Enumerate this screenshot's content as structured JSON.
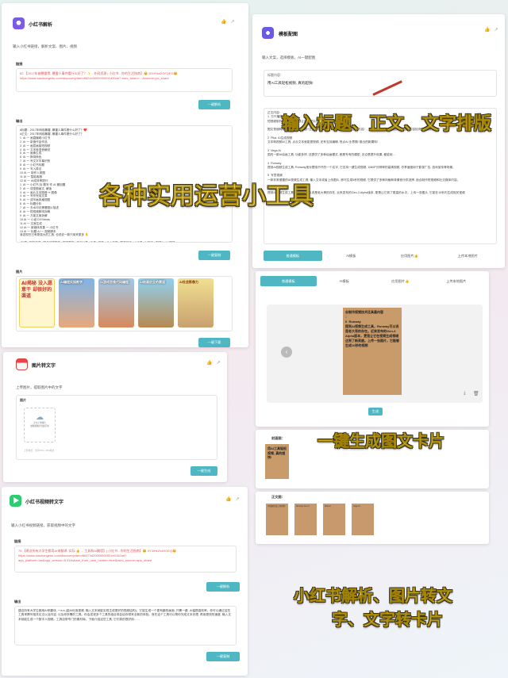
{
  "p1": {
    "title": "小红书解析",
    "subtitle": "输入小红书链接，解析文案、图片、视频",
    "link_label": "链接",
    "link_text": "62 【2017年被暴雷黑, 暴雷人事件看什么好了？✨ - 外网资源 | 小红书 - 你的生活指南】😊 2EHYkeZGFQEG😊 https://www.xiaohongshu.com/discovery/item/6624c0000000001d00ab? xsec_token=...&source=pc_share",
    "parse_button": "一键解析",
    "output_label": "输出",
    "output_lines": [
      "#标题：2017年网络暴雷, 暴雷人事件看什么好了？❤️",
      "#正文：2017年网络暴雷, 暴雷人事件看什么好了？",
      "1  AI 一 画直播助小红书",
      "2  AI 一 制造作品作品",
      "3  AI 一 画层画接短视频",
      "4  AI 一 文本转语音解说",
      "5  AI 一 画像生成",
      "6  AI 一 换背换色",
      "7  AI 一 写文字字幕识别",
      "8  AI 一 小红书标题",
      "9  AI 一 写入算法",
      "10 AI 一 制作人类图",
      "11 AI 一 智能客服",
      "12 AI 一 AI成效率提升",
      "1  AI 一 小红书 标 题写 作 AI 撤回置",
      "2  AI 一 成型图画文, 解读",
      "3  AI 一 画片文本图像 ✈ 图像",
      "4  AI 一 写作完成文章",
      "5  AI 一 成写画风格视图",
      "6  AI 一 标题分析",
      "7  AI 一 去水印无需看图片描述",
      "8  AI 一 短视频脚本拆解",
      "9  AI 一 万能文案拆解",
      "10 AI 一 小纸 DIY/Ideas",
      "11 AI 一 文案生成",
      "12 AI 一 新媒体改善 一 小红书",
      "13 AI 一 标题 AI 一 视频脚本",
      "我发现在已有更强大的工具, 也说说一款只用来更多 ✋",
      "",
      "#标签 #职场效率 #精品效率推荐 #视频教程 #用户分享 #工具 #学生 #个人效率 #职场技巧 #AI工具 #AI知识 #视频AI #AI视频"
    ],
    "copy_button": "一键复制",
    "images_label": "图片",
    "thumbs": [
      "AI揭秘 没入愿意干 却很好的渠道",
      "AI编程实操教学",
      "AI游戏思维代码编程",
      "AI绘画创业的赛道",
      "AI社会影像力"
    ],
    "download_button": "一键下载"
  },
  "p2": {
    "title": "模板配图",
    "subtitle": "输入文案，选择模板，AI一键配图",
    "title_label": "标题内容：",
    "title_value": "用AI工具轻松视频, 真的超快!",
    "body_label": "正文内容：",
    "body_lines": [
      "1  万兴播爆",
      "短视频制作的AI工具, 能够让原本复杂的视频制作变得简单...",
      "",
      "图文快速转视频: 一键生成标题+正文+故障标题, 一键发布（封面+正文内容）, 支持自己的模板, 然后对AI生图, 内容检测, 一键发布。",
      "",
      "2  Pika  AI生成视频",
      "文本转视频AI工具, 点点文本就能更视频, 还有支持编辑, 快点AI 业界颇/ 推出的新模特!",
      "",
      "3  Vega AI",
      "国内一款AI绘画工具, 功能多样, 还提供了多种绘画模式, 都是专有的模型, 无论是提升效果, 都能用...",
      "",
      "4  Runway",
      "提到AI视频生成工具, Runway绝对是绕不开的一个名字, 它支持一键生成视频, 1080P分辨率的高清视频, 尽享速度用于影视广告, 游戏宣传等场景。",
      "",
      "5  写意视频",
      "一款非常便捷的AI视频生成工具, 输入文本或者上传图片, 即可生成5秒的视频, 它提供了多种风格和背景音乐供选择, 适合制作短视频和社交媒体内容。",
      "",
      "6  Runway",
      "提到AI视频生成工具, Runway可以说是老大哥的存在, 近来发布的Gen-3 Alpha版本, 更是让它到了更高的水平。上传一张图片, 它能在10秒内生成相关视频"
    ],
    "tabs": [
      "普通模板",
      "AI模板",
      "应用图片👍",
      "上传本地图片"
    ],
    "carousel_tabs": [
      "普通模板",
      "AI模板",
      "应用图片👍",
      "上传本地图片"
    ],
    "card_text": "谷制作视频技术还具最内容\n：\n6  Runway\n提到AI视频生成工具，Runway可以说是老大哥的存在。近来发布的Gen-3 Alpha版本，更是让它在视频生成领域达到了新高度。上传一张图片，它能够生成10秒的视频",
    "generate_button": "生成",
    "cover_label": "封面图：",
    "cover_text": "用AI工具轻松视频, 真的超快!",
    "body_img_label": "正文图："
  },
  "p3": {
    "title": "图片转文字",
    "subtitle": "上传图片，提取图片中的文字",
    "img_label": "图片",
    "upload_text": "点击上传图片\n或拖拽图片到此区域",
    "hint": "上传格式：支持PNG, JPG格式",
    "button": "一键生成"
  },
  "p4": {
    "title": "小红书视频转文字",
    "subtitle": "输入小红书视频链接，获取视频中的文字",
    "link_label": "链接",
    "link_text": "75 【建议所有大学生都用AI来翻译, 实际 👍 ... 工具和AI翻墙】| 小红书 - 你的生活指南】😊 4Y3iHeZvxHGEQ😊 https://www.xiaohongshu.com/discovery/item/66374420000000001e0162ad?app_platform=ios&app_version=8.31&share_from_user_hidden=true&xsec_source=app_share",
    "parse_button": "一键解析",
    "output_label": "输出",
    "output_text": "建议所有大学生都用AI来翻译, 一a a (能AI化用视频, 输入文本就能实现生成更好的视频结构)。它能生成一个更有趣的画面, 只需一键, 大幅提高效率。你可以通过这些工具来撰写相关论文以及内容, 以及你所需的工具。你会发现多个工具的组合将会给你带来全新的体验。首先这个工具可以帮你完成文本处理, 再用更快的速度, 输入文本就能生成一个数字人视频。工具自带专门的素材库。下面介绍这些工具, 它们真的很好用……",
    "copy_button": "一键复制"
  },
  "overlays": {
    "tools": "各种实用运营小工具",
    "input": "输入标题、正文、文字排版",
    "card": "一键生成图文卡片",
    "summary_1": "小红书解析、图片转文",
    "summary_2": "字、文字转卡片"
  },
  "icons": {
    "like": "thumbs-up-icon",
    "share": "share-icon",
    "prev": "chevron-left-icon",
    "download": "download-icon",
    "delete": "trash-icon"
  }
}
